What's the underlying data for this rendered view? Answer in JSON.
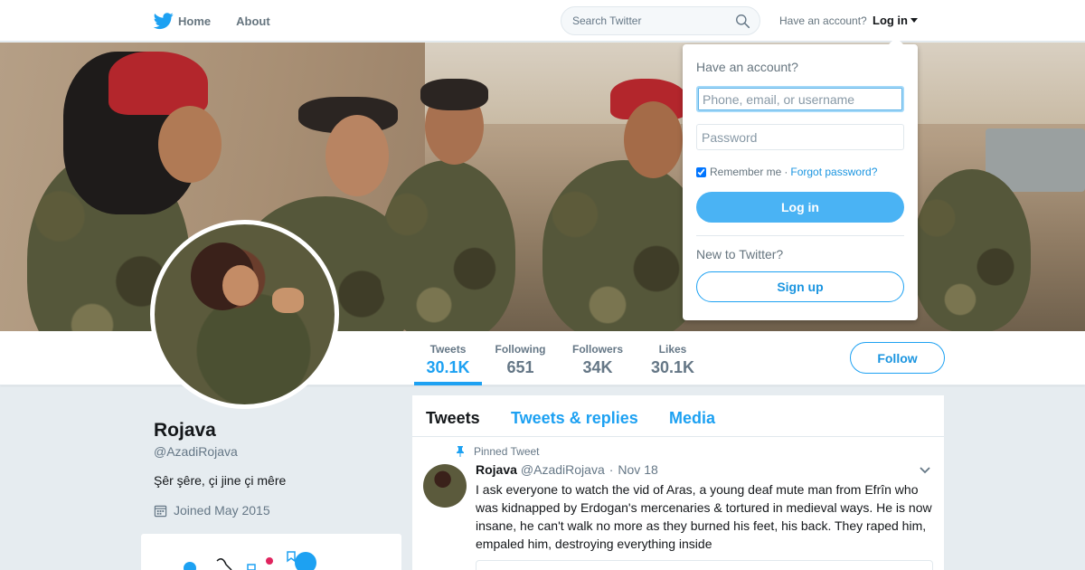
{
  "nav": {
    "home_label": "Home",
    "about_label": "About",
    "search_placeholder": "Search Twitter",
    "have_account": "Have an account?",
    "login_label": "Log in"
  },
  "login_dropdown": {
    "heading": "Have an account?",
    "username_placeholder": "Phone, email, or username",
    "password_placeholder": "Password",
    "remember_label": "Remember me",
    "separator": "·",
    "forgot_label": "Forgot password?",
    "login_button": "Log in",
    "new_label": "New to Twitter?",
    "signup_button": "Sign up"
  },
  "stats": [
    {
      "label": "Tweets",
      "value": "30.1K",
      "active": true
    },
    {
      "label": "Following",
      "value": "651",
      "active": false
    },
    {
      "label": "Followers",
      "value": "34K",
      "active": false
    },
    {
      "label": "Likes",
      "value": "30.1K",
      "active": false
    }
  ],
  "follow_button": "Follow",
  "profile": {
    "name": "Rojava",
    "handle": "@AzadiRojava",
    "bio": "Şêr şêre, çi jine çi mêre",
    "joined": "Joined May 2015"
  },
  "timeline": {
    "tabs": [
      {
        "label": "Tweets",
        "active": true
      },
      {
        "label": "Tweets & replies",
        "active": false
      },
      {
        "label": "Media",
        "active": false
      }
    ],
    "pinned_label": "Pinned Tweet",
    "tweet": {
      "name": "Rojava",
      "handle": "@AzadiRojava",
      "dot": "·",
      "time": "Nov 18",
      "text": "I ask everyone to watch the vid of Aras, a young deaf mute man from Efrîn who was kidnapped by Erdogan's mercenaries & tortured in medieval ways. He is now insane, he can't walk no more as they burned his feet, his back. They raped him, empaled him, destroying everything inside"
    }
  },
  "colors": {
    "accent": "#1da1f2",
    "background": "#e6ecf0",
    "login_button": "#4ab3f4"
  },
  "icons": [
    "twitter-bird-icon",
    "search-icon",
    "caret-down-icon",
    "calendar-icon",
    "pin-icon",
    "chevron-down-icon"
  ]
}
